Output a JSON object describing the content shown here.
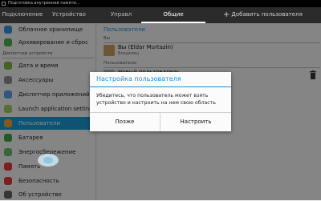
{
  "status_bar": {
    "notification": "Подготовка внутренней памяти..."
  },
  "tabs": [
    {
      "label": "Подключение"
    },
    {
      "label": "Устройство"
    },
    {
      "label": "Управл"
    },
    {
      "label": "Общие",
      "active": true
    }
  ],
  "header": {
    "add_user_label": "Добавить пользователя"
  },
  "sidebar": {
    "items_top": [
      {
        "label": "Облачное хранилище",
        "icon": "cloud-icon",
        "color": "#3d8fd9"
      },
      {
        "label": "Архивирование и сброс",
        "icon": "backup-icon",
        "color": "#4caf50"
      }
    ],
    "section_header": "Диспетчер устройств",
    "items": [
      {
        "label": "Дата и время",
        "icon": "clock-icon",
        "color": "#7cb342"
      },
      {
        "label": "Аксессуары",
        "icon": "accessory-icon",
        "color": "#8e8e8e"
      },
      {
        "label": "Диспетчер приложений",
        "icon": "apps-icon",
        "color": "#5c9ce6"
      },
      {
        "label": "Launch application setting",
        "icon": "launch-icon",
        "color": "#9ccc65"
      },
      {
        "label": "Пользователи",
        "icon": "users-icon",
        "color": "#f0a030",
        "selected": true
      },
      {
        "label": "Батарея",
        "icon": "battery-icon",
        "color": "#43a047"
      },
      {
        "label": "Энергосбережение",
        "icon": "power-icon",
        "color": "#66bb6a"
      },
      {
        "label": "Память",
        "icon": "storage-icon",
        "color": "#e53935"
      },
      {
        "label": "Безопасность",
        "icon": "lock-icon",
        "color": "#e53935"
      },
      {
        "label": "Об устройстве",
        "icon": "info-icon",
        "color": "#616161"
      }
    ]
  },
  "content": {
    "section_title": "Пользователи",
    "you_label": "Вы",
    "owner": {
      "name": "Вы (Eldar Murtazin)",
      "role": "Владелец"
    },
    "users_label": "Пользователи",
    "new_user": {
      "name": "Новый пользователь"
    }
  },
  "dialog": {
    "title": "Настройка пользователя",
    "message": "Убедитесь, что пользователь может взять устройство и настроить на нем свою область",
    "later_label": "Позже",
    "setup_label": "Настроить"
  },
  "colors": {
    "accent": "#1c97d2",
    "tab_bar": "#2b2b2b",
    "status_bar": "#000000"
  }
}
